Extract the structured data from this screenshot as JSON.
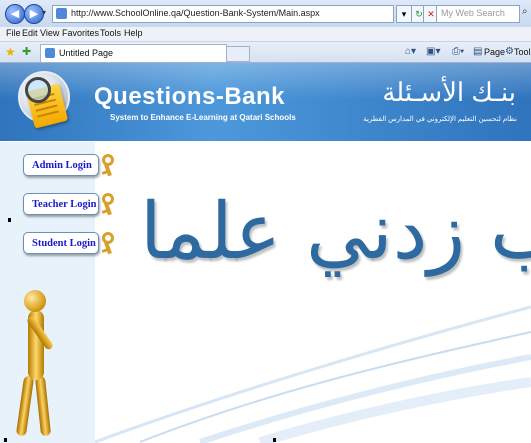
{
  "browser": {
    "url": "http://www.SchoolOnline.qa/Question-Bank-System/Main.aspx",
    "search_placeholder": "My Web Search",
    "menu": [
      "File",
      "Edit",
      "View",
      "Favorites",
      "Tools",
      "Help"
    ],
    "tab_title": "Untitled Page",
    "tools": {
      "page_label": "Page",
      "tools_label": "Tools"
    }
  },
  "header": {
    "title_en": "Questions-Bank",
    "subtitle_en": "System to Enhance E-Learning at Qatari Schools",
    "title_ar": "بنـك الأسـئلة",
    "subtitle_ar": "نظام لتحسين التعليم الإلكتروني في المدارس القطرية"
  },
  "sidebar": {
    "logins": [
      {
        "label": "Admin Login"
      },
      {
        "label": "Teacher Login"
      },
      {
        "label": "Student Login"
      }
    ]
  },
  "main": {
    "calligraphy_text": "وقل رب زدني علما"
  },
  "colors": {
    "banner": "#3a84cc",
    "login_text": "#1a1acc",
    "calligraphy": "#2e6aa0",
    "sidebar_bg": "#e7f2fb"
  }
}
